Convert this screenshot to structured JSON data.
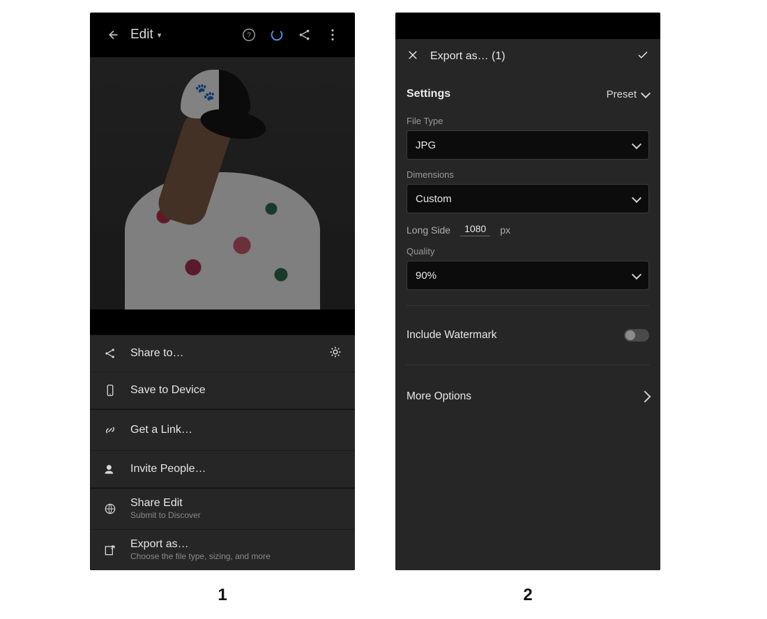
{
  "screen1": {
    "header": {
      "title": "Edit"
    },
    "share_menu": {
      "share_to": {
        "label": "Share to…"
      },
      "save": {
        "label": "Save to Device"
      },
      "get_link": {
        "label": "Get a Link…"
      },
      "invite": {
        "label": "Invite People…"
      },
      "share_edit": {
        "label": "Share Edit",
        "sub": "Submit to Discover"
      },
      "export_as": {
        "label": "Export as…",
        "sub": "Choose the file type, sizing, and more"
      }
    }
  },
  "screen2": {
    "header": {
      "title": "Export as… (1)"
    },
    "settings_label": "Settings",
    "preset_label": "Preset",
    "file_type": {
      "label": "File Type",
      "value": "JPG"
    },
    "dimensions": {
      "label": "Dimensions",
      "value": "Custom"
    },
    "long_side": {
      "label": "Long Side",
      "value": "1080",
      "unit": "px"
    },
    "quality": {
      "label": "Quality",
      "value": "90%"
    },
    "watermark": {
      "label": "Include Watermark",
      "on": false
    },
    "more": {
      "label": "More Options"
    }
  },
  "captions": {
    "one": "1",
    "two": "2"
  }
}
